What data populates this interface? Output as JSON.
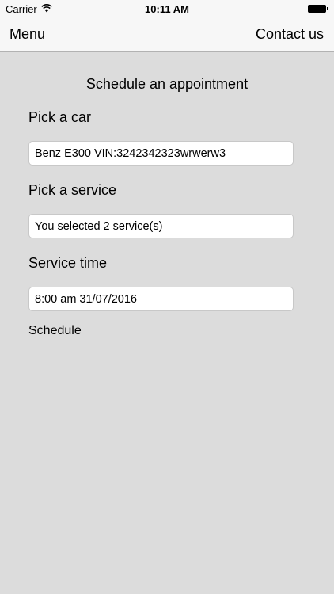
{
  "status_bar": {
    "carrier": "Carrier",
    "time": "10:11 AM",
    "icons": [
      "wifi-icon",
      "battery-icon"
    ]
  },
  "nav": {
    "menu_label": "Menu",
    "contact_label": "Contact us"
  },
  "page": {
    "title": "Schedule an appointment"
  },
  "form": {
    "car_label": "Pick a car",
    "car_value": "Benz E300 VIN:3242342323wrwerw3",
    "service_label": "Pick a service",
    "service_value": "You selected 2 service(s)",
    "time_label": "Service time",
    "time_value": "8:00 am 31/07/2016",
    "schedule_label": "Schedule"
  },
  "colors": {
    "background": "#dcdcdc",
    "bar": "#f7f7f7",
    "field": "#ffffff"
  }
}
